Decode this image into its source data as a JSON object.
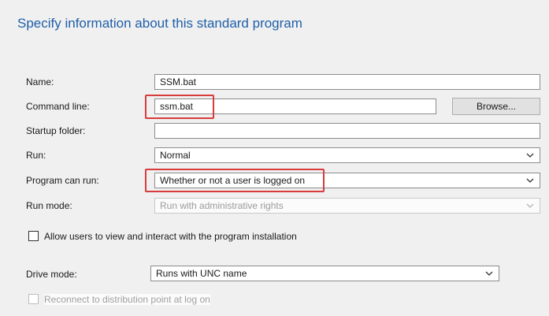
{
  "page": {
    "title": "Specify information about this standard program"
  },
  "form": {
    "name": {
      "label": "Name:",
      "value": "SSM.bat"
    },
    "command_line": {
      "label": "Command line:",
      "value": "ssm.bat",
      "browse_label": "Browse..."
    },
    "startup_folder": {
      "label": "Startup folder:",
      "value": ""
    },
    "run": {
      "label": "Run:",
      "value": "Normal"
    },
    "program_can_run": {
      "label": "Program can run:",
      "value": "Whether or not a user is logged on"
    },
    "run_mode": {
      "label": "Run mode:",
      "value": "Run with administrative rights"
    },
    "allow_interact": {
      "label": "Allow users to view and interact with the program installation",
      "checked": false
    },
    "drive_mode": {
      "label": "Drive mode:",
      "value": "Runs with UNC name"
    },
    "reconnect": {
      "label": "Reconnect to distribution point at log on",
      "checked": false,
      "disabled": true
    }
  },
  "annotations": {
    "highlight_color": "#d83b3b"
  },
  "icons": {
    "dropdown": "chevron-down-icon"
  }
}
